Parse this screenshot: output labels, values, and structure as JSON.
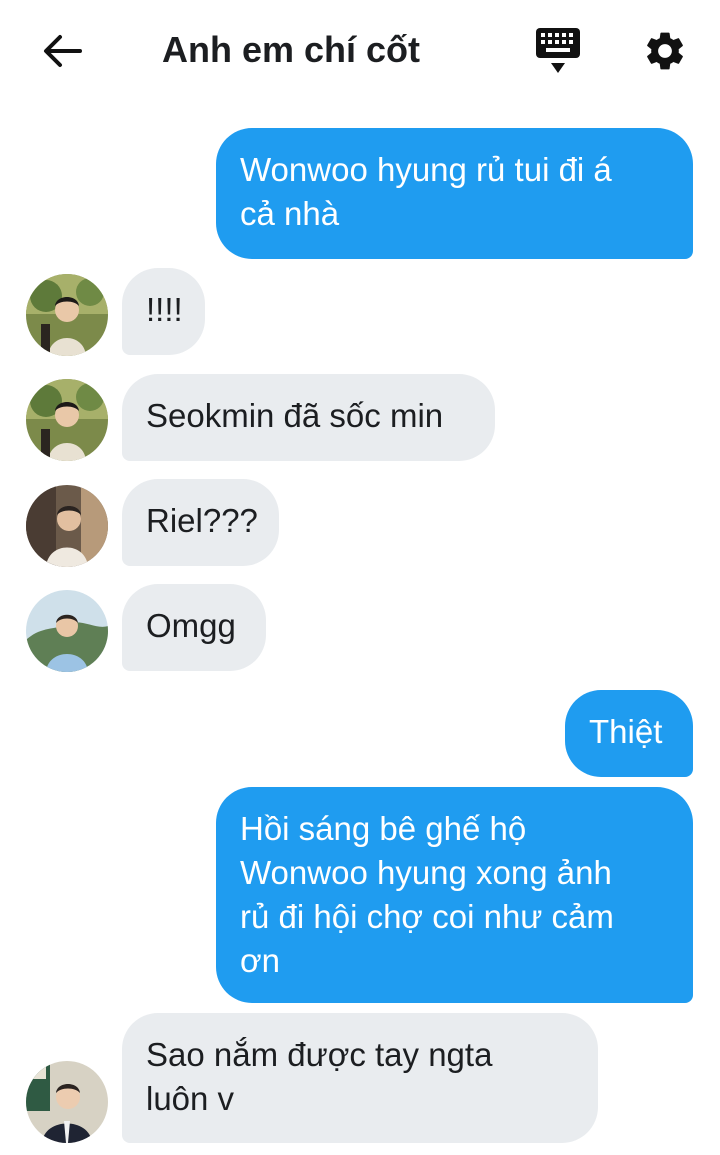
{
  "header": {
    "title": "Anh em chí cốt",
    "back_icon": "arrow-left-icon",
    "keyboard_icon": "keyboard-icon",
    "settings_icon": "gear-icon"
  },
  "messages": [
    {
      "id": "m1",
      "direction": "outgoing",
      "text": "Wonwoo hyung rủ tui đi á\ncả nhà"
    },
    {
      "id": "m2",
      "direction": "incoming",
      "text": "!!!!"
    },
    {
      "id": "m3",
      "direction": "incoming",
      "text": "Seokmin đã sốc min"
    },
    {
      "id": "m4",
      "direction": "incoming",
      "text": "Riel???"
    },
    {
      "id": "m5",
      "direction": "incoming",
      "text": "Omgg"
    },
    {
      "id": "m6",
      "direction": "outgoing",
      "text": "Thiệt"
    },
    {
      "id": "m7",
      "direction": "outgoing",
      "text": "Hồi sáng bê ghế hộ\nWonwoo hyung xong ảnh\nrủ đi hội chợ coi như cảm\nơn"
    },
    {
      "id": "m8",
      "direction": "incoming",
      "text": "Sao nắm được tay ngta\nluôn v"
    }
  ],
  "colors": {
    "outgoing_bubble": "#1f9cf0",
    "incoming_bubble": "#e9ecef"
  }
}
